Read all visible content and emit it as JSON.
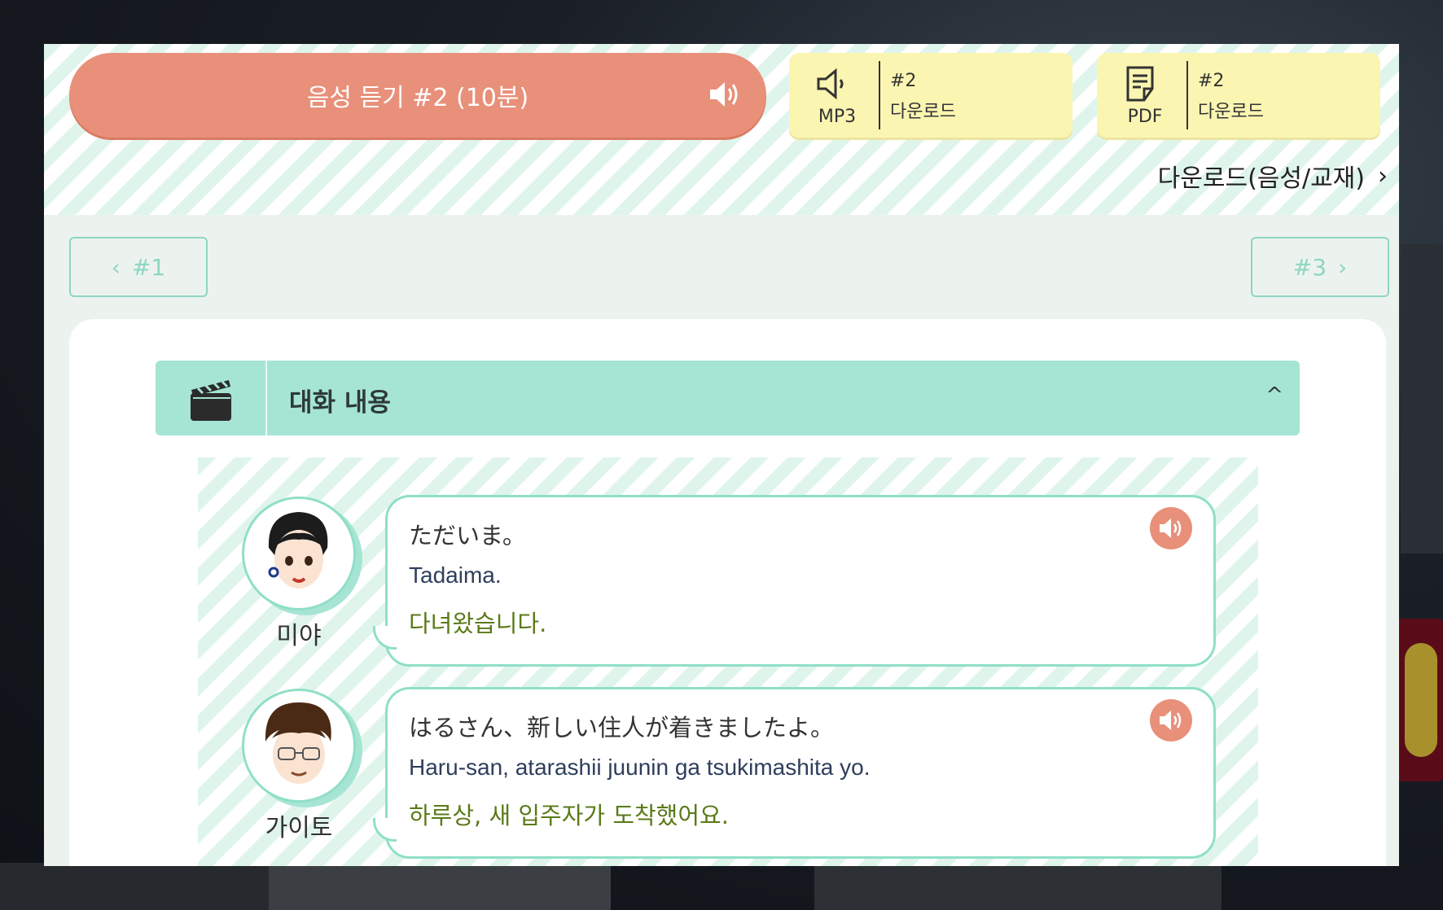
{
  "audio_button": {
    "label": "음성 듣기 #2 (10분)"
  },
  "downloads": [
    {
      "type": "MP3",
      "number": "#2",
      "label": "다운로드"
    },
    {
      "type": "PDF",
      "number": "#2",
      "label": "다운로드"
    }
  ],
  "download_link": {
    "label": "다운로드(음성/교재)",
    "chevron": "›"
  },
  "nav": {
    "prev": {
      "label": "#1",
      "chevron": "‹"
    },
    "next": {
      "label": "#3",
      "chevron": "›"
    }
  },
  "section": {
    "title": "대화 내용",
    "caret": "^"
  },
  "messages": [
    {
      "speaker": "미야",
      "japanese": "ただいま。",
      "romaji": "Tadaima.",
      "korean": "다녀왔습니다."
    },
    {
      "speaker": "가이토",
      "japanese": "はるさん、新しい住人が着きましたよ。",
      "romaji": "Haru-san, atarashii juunin ga tsukimashita yo.",
      "korean": "하루상, 새 입주자가 도착했어요."
    }
  ],
  "colors": {
    "accent_coral": "#e8907a",
    "mint": "#a6e5d3",
    "download_yellow": "#fbf5b2",
    "korean_text": "#5a7a18"
  }
}
